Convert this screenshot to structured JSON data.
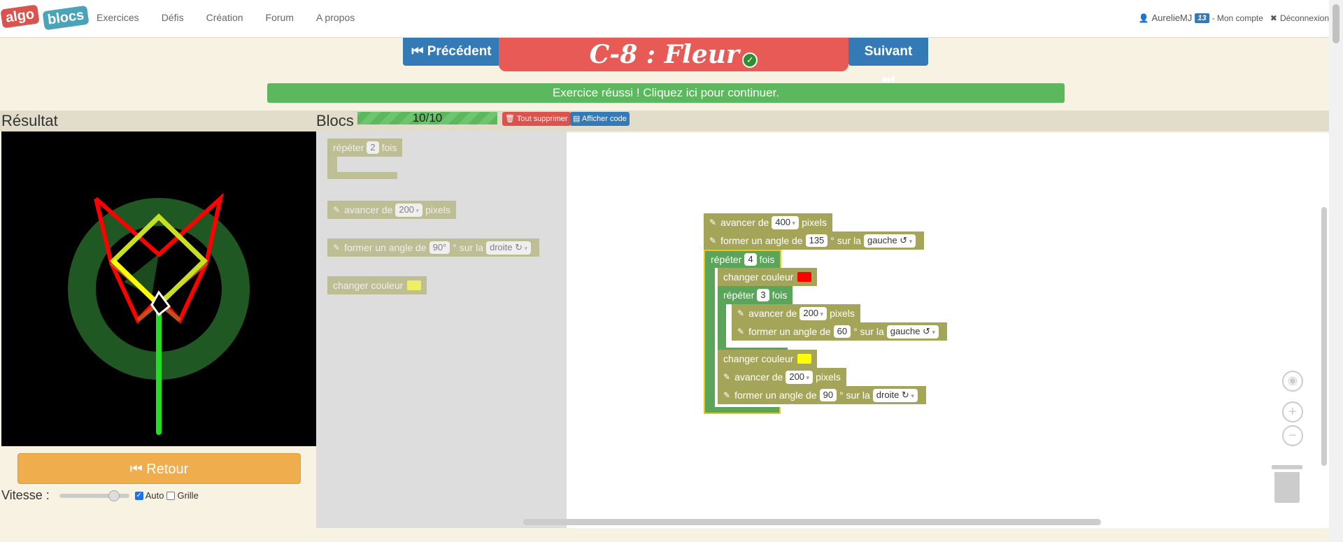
{
  "nav": {
    "logo_part1": "algo",
    "logo_part2": "blocs",
    "links": [
      "Exercices",
      "Défis",
      "Création",
      "Forum",
      "A propos"
    ],
    "user": "AurelieMJ",
    "user_badge": "13",
    "account": "- Mon compte",
    "logout": "Déconnexion"
  },
  "header": {
    "prev_label": "Précédent",
    "next_label": "Suivant",
    "title": "C-8 : Fleur",
    "success_message": "Exercice réussi ! Cliquez ici pour continuer."
  },
  "result": {
    "label": "Résultat",
    "retour_label": "Retour",
    "speed_label": "Vitesse :",
    "auto_label": "Auto",
    "auto_checked": true,
    "grid_label": "Grille",
    "grid_checked": false
  },
  "blocks_header": {
    "label": "Blocs",
    "progress_text": "10/10",
    "progress_value": 1.0,
    "delete_all_label": "Tout supprimer",
    "show_code_label": "Afficher code"
  },
  "toolbox": {
    "repeat": {
      "pre": "répéter",
      "value": "2",
      "post": "fois"
    },
    "forward": {
      "pre": "avancer de",
      "value": "200",
      "post": "pixels"
    },
    "turn": {
      "pre": "former un angle de",
      "value": "90°",
      "mid": "° sur la",
      "dir": "droite ↻"
    },
    "color": {
      "label": "changer couleur",
      "color": "#ffff00"
    }
  },
  "program": {
    "b1": {
      "pre": "avancer de",
      "value": "400",
      "post": "pixels"
    },
    "b2": {
      "pre": "former un angle de",
      "value": "135",
      "mid": "° sur la",
      "dir": "gauche ↺"
    },
    "loop1": {
      "pre": "répéter",
      "value": "4",
      "post": "fois"
    },
    "c1": {
      "label": "changer couleur",
      "color": "#ff0000"
    },
    "loop2": {
      "pre": "répéter",
      "value": "3",
      "post": "fois"
    },
    "b3": {
      "pre": "avancer de",
      "value": "200",
      "post": "pixels"
    },
    "b4": {
      "pre": "former un angle de",
      "value": "60",
      "mid": "° sur la",
      "dir": "gauche ↺"
    },
    "c2": {
      "label": "changer couleur",
      "color": "#ffff00"
    },
    "b5": {
      "pre": "avancer de",
      "value": "200",
      "post": "pixels"
    },
    "b6": {
      "pre": "former un angle de",
      "value": "90",
      "mid": "° sur la",
      "dir": "droite ↻"
    }
  },
  "colors": {
    "title_band": "#e85a55",
    "success": "#5cb85c",
    "primary": "#337ab7",
    "retour": "#f0ad4e",
    "block": "#a5a55a",
    "loop": "#5ba55b"
  }
}
